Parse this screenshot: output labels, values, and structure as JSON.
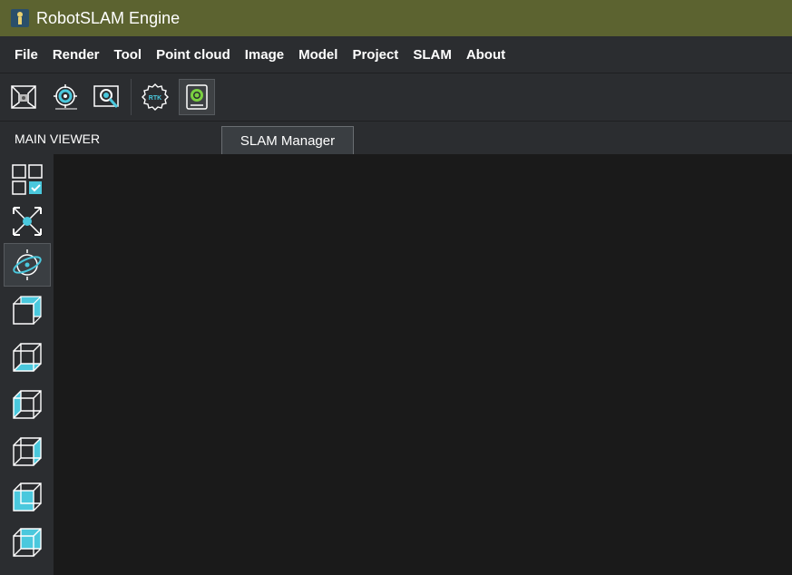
{
  "window": {
    "title": "RobotSLAM Engine"
  },
  "menu": [
    "File",
    "Render",
    "Tool",
    "Point cloud",
    "Image",
    "Model",
    "Project",
    "SLAM",
    "About"
  ],
  "toolbar": {
    "icons": [
      "camera-calibration-icon",
      "lidar-scan-icon",
      "image-search-icon",
      "rtk-settings-icon",
      "slam-manager-icon"
    ],
    "rtk_label": "RTK"
  },
  "viewer": {
    "title": "MAIN VIEWER"
  },
  "tooltip": {
    "text": "SLAM Manager"
  },
  "sidebar": {
    "icons": [
      "grid-select-icon",
      "fit-view-icon",
      "orbit-icon",
      "view-front-icon",
      "view-bottom-icon",
      "view-left-icon",
      "view-right-icon",
      "view-top-icon",
      "view-back-icon"
    ]
  },
  "colors": {
    "accent": "#4ac8dd",
    "titlebar": "#5c6330",
    "panel": "#2b2d30",
    "viewport": "#1a1a1a",
    "green": "#7ad040"
  }
}
